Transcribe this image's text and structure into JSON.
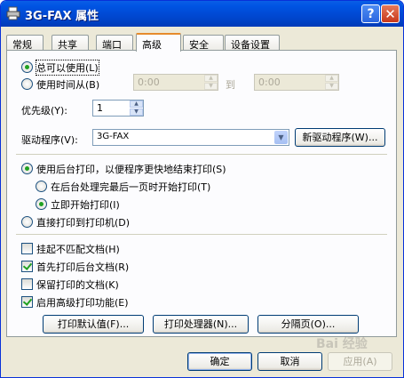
{
  "window": {
    "title": "3G-FAX 属性",
    "help_label": "?",
    "close_label": "✕"
  },
  "tabs": [
    "常规",
    "共享",
    "端口",
    "高级",
    "安全",
    "设备设置"
  ],
  "availability": {
    "always_label": "总可以使用(L)",
    "from_label": "使用时间从(B)",
    "start_time": "0:00",
    "to_label": "到",
    "end_time": "0:00"
  },
  "priority": {
    "label": "优先级(Y):",
    "value": "1"
  },
  "driver": {
    "label": "驱动程序(V):",
    "value": "3G-FAX",
    "new_button": "新驱动程序(W)..."
  },
  "spool": {
    "spool_label": "使用后台打印，以便程序更快地结束打印(S)",
    "after_last_page": "在后台处理完最后一页时开始打印(T)",
    "immediately": "立即开始打印(I)",
    "direct": "直接打印到打印机(D)"
  },
  "options": {
    "hold_mismatched": "挂起不匹配文档(H)",
    "print_spooled_first": "首先打印后台文档(R)",
    "keep_printed": "保留打印的文档(K)",
    "advanced_features": "启用高级打印功能(E)"
  },
  "bottom_buttons": {
    "defaults": "打印默认值(F)...",
    "processor": "打印处理器(N)...",
    "separator": "分隔页(O)..."
  },
  "dialog_buttons": {
    "ok": "确定",
    "cancel": "取消",
    "apply": "应用(A)"
  },
  "watermark": "Bai 经验"
}
